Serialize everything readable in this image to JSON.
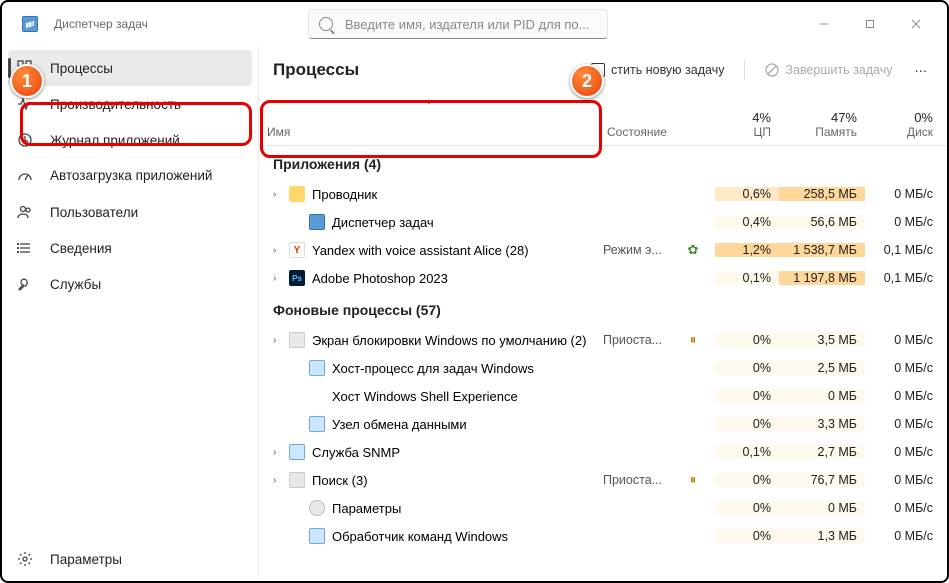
{
  "app": {
    "title": "Диспетчер задач"
  },
  "search": {
    "placeholder": "Введите имя, издателя или PID для по..."
  },
  "sidebar": {
    "items": [
      {
        "label": "Процессы"
      },
      {
        "label": "Производительность"
      },
      {
        "label": "Журнал приложений"
      },
      {
        "label": "Автозагрузка приложений"
      },
      {
        "label": "Пользователи"
      },
      {
        "label": "Сведения"
      },
      {
        "label": "Службы"
      }
    ],
    "settings": "Параметры"
  },
  "toolbar": {
    "title": "Процессы",
    "run_new": "стить новую задачу",
    "end_task": "Завершить задачу"
  },
  "headers": {
    "name": "Имя",
    "status": "Состояние",
    "cpu_pct": "4%",
    "cpu": "ЦП",
    "mem_pct": "47%",
    "mem": "Память",
    "disk_pct": "0%",
    "disk": "Диск"
  },
  "groups": {
    "apps": "Приложения (4)",
    "bg": "Фоновые процессы (57)"
  },
  "rows": [
    {
      "g": "apps",
      "exp": true,
      "icon": "folder",
      "name": "Проводник",
      "status": "",
      "leaf": "",
      "cpu": "0,6%",
      "mem": "258,5 МБ",
      "disk": "0 МБ/с",
      "cpu_h": "md",
      "mem_h": "hi"
    },
    {
      "g": "apps",
      "exp": false,
      "indent": 1,
      "icon": "tm",
      "name": "Диспетчер задач",
      "status": "",
      "leaf": "",
      "cpu": "0,4%",
      "mem": "56,6 МБ",
      "disk": "0 МБ/с",
      "cpu_h": "",
      "mem_h": "lo"
    },
    {
      "g": "apps",
      "exp": true,
      "icon": "y",
      "name": "Yandex with voice assistant Alice (28)",
      "status": "Режим э...",
      "leaf": "leaf",
      "cpu": "1,2%",
      "mem": "1 538,7 МБ",
      "disk": "0,1 МБ/с",
      "cpu_h": "hi",
      "mem_h": "hi"
    },
    {
      "g": "apps",
      "exp": true,
      "icon": "ps",
      "name": "Adobe Photoshop 2023",
      "status": "",
      "leaf": "",
      "cpu": "0,1%",
      "mem": "1 197,8 МБ",
      "disk": "0,1 МБ/с",
      "cpu_h": "",
      "mem_h": "hi"
    },
    {
      "g": "bg",
      "exp": true,
      "icon": "blank",
      "name": "Экран блокировки Windows по умолчанию (2)",
      "status": "Приоста...",
      "leaf": "pause",
      "cpu": "0%",
      "mem": "3,5 МБ",
      "disk": "0 МБ/с"
    },
    {
      "g": "bg",
      "exp": false,
      "indent": 1,
      "icon": "gen",
      "name": "Хост-процесс для задач Windows",
      "status": "",
      "leaf": "",
      "cpu": "0%",
      "mem": "2,5 МБ",
      "disk": "0 МБ/с"
    },
    {
      "g": "bg",
      "exp": false,
      "indent": 1,
      "icon": "none",
      "name": "Хост Windows Shell Experience",
      "status": "",
      "leaf": "",
      "cpu": "0%",
      "mem": "0 МБ",
      "disk": "0 МБ/с"
    },
    {
      "g": "bg",
      "exp": false,
      "indent": 1,
      "icon": "gen",
      "name": "Узел обмена данными",
      "status": "",
      "leaf": "",
      "cpu": "0%",
      "mem": "3,3 МБ",
      "disk": "0 МБ/с"
    },
    {
      "g": "bg",
      "exp": true,
      "icon": "gen",
      "name": "Служба SNMP",
      "status": "",
      "leaf": "",
      "cpu": "0,1%",
      "mem": "2,7 МБ",
      "disk": "0 МБ/с"
    },
    {
      "g": "bg",
      "exp": true,
      "icon": "blank",
      "name": "Поиск (3)",
      "status": "Приоста...",
      "leaf": "pause",
      "cpu": "0%",
      "mem": "76,7 МБ",
      "disk": "0 МБ/с"
    },
    {
      "g": "bg",
      "exp": false,
      "indent": 1,
      "icon": "gear",
      "name": "Параметры",
      "status": "",
      "leaf": "",
      "cpu": "0%",
      "mem": "0 МБ",
      "disk": "0 МБ/с"
    },
    {
      "g": "bg",
      "exp": false,
      "indent": 1,
      "icon": "gen",
      "name": "Обработчик команд Windows",
      "status": "",
      "leaf": "",
      "cpu": "0%",
      "mem": "1,3 МБ",
      "disk": "0 МБ/с"
    }
  ]
}
